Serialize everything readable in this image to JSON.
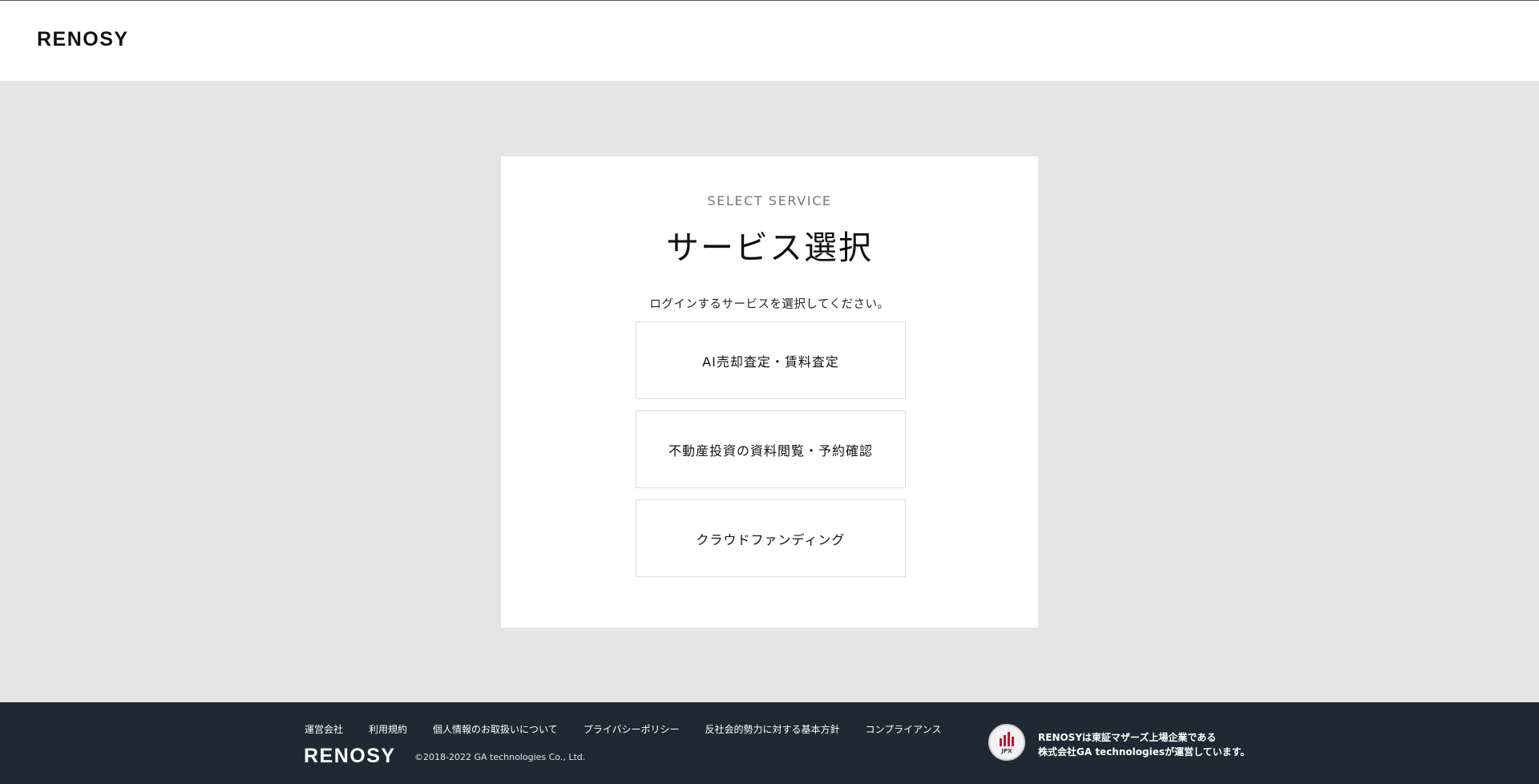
{
  "header": {
    "logo": "RENOSY"
  },
  "card": {
    "eyebrow": "SELECT SERVICE",
    "title": "サービス選択",
    "description": "ログインするサービスを選択してください。",
    "services": [
      {
        "label": "AI売却査定・賃料査定"
      },
      {
        "label": "不動産投資の資料閲覧・予約確認"
      },
      {
        "label": "クラウドファンディング"
      }
    ]
  },
  "footer": {
    "links": [
      "運営会社",
      "利用規約",
      "個人情報のお取扱いについて",
      "プライバシーポリシー",
      "反社会的勢力に対する基本方針",
      "コンプライアンス"
    ],
    "logo": "RENOSY",
    "copyright": "©2018-2022 GA technologies Co., Ltd.",
    "badge_text": "JPX",
    "listed_line1": "RENOSYは東証マザーズ上場企業である",
    "listed_line2": "株式会社GA technologiesが運営しています。"
  },
  "colors": {
    "page_bg": "#e5e5e5",
    "footer_bg": "#1f2833",
    "card_bg": "#ffffff",
    "badge_red": "#c8102e"
  }
}
